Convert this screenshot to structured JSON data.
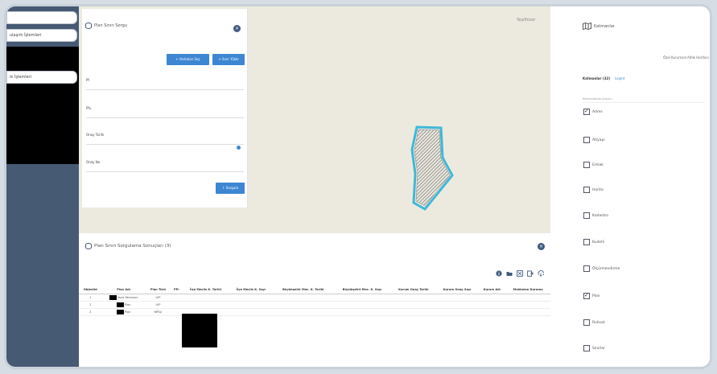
{
  "sidebar": {
    "items": [
      {
        "label": ""
      },
      {
        "label": "ulaşım İşlemleri"
      },
      {
        "label": ""
      },
      {
        "label": "ik İşlemleri"
      }
    ]
  },
  "map": {
    "place_label": "Yeşilhisar"
  },
  "search_panel": {
    "title": "Plan Sınırı Sorgu",
    "close_icon": "close-icon",
    "buttons": {
      "vertex": "+ Verkalan Seç",
      "draw": "+ Sınır Yükle",
      "query": "↑ Sorgula"
    },
    "fields": [
      {
        "label": "Pf."
      },
      {
        "label": "Pfv."
      },
      {
        "label": "Onay Tarihi"
      },
      {
        "label": "Onay No"
      }
    ]
  },
  "results": {
    "title": "Plan Sınırı Sorgulama Sonuçları (3)",
    "columns": [
      "Objectid",
      "Plan Adı",
      "Plan Türü",
      "PPı",
      "İlçe Meclis K. Tarihi",
      "İlçe Meclis K. Sayı",
      "Büyükşehir Mec. K. Tarihi",
      "Büyükşehir Mec. K. Sayı",
      "Kurum Onay Tarihi",
      "Kurum Onay Sayı",
      "Kurum Adı",
      "Mahkeme Durumu"
    ],
    "rows": [
      {
        "id": "1",
        "plan_adi": "İlave Revizyon",
        "plan_turu": "UIP"
      },
      {
        "id": "2",
        "plan_adi": "Plan",
        "plan_turu": "UIP"
      },
      {
        "id": "3",
        "plan_adi": "Plan",
        "plan_turu": "NPİİçi"
      }
    ]
  },
  "layers": {
    "title": "Katmanlar",
    "basemap": "Özel Kurumsal Altlık Haritası",
    "tabs": {
      "layers": "Katmanlar (32)",
      "legend": "Lejant"
    },
    "search_placeholder": "Katmanlarda Arayın...",
    "items": [
      {
        "label": "Adres",
        "checked": true
      },
      {
        "label": "Altyapı",
        "checked": false
      },
      {
        "label": "Emlak",
        "checked": false
      },
      {
        "label": "Harita",
        "checked": false
      },
      {
        "label": "Kadastro",
        "checked": false
      },
      {
        "label": "Kudelli",
        "checked": false
      },
      {
        "label": "Ölçümlendirme",
        "checked": false
      },
      {
        "label": "Plan",
        "checked": true
      },
      {
        "label": "Ruhsat",
        "checked": false
      },
      {
        "label": "Sınırlar",
        "checked": false
      }
    ]
  },
  "colors": {
    "accent": "#3d86d3",
    "sidebar": "#475a74",
    "parcel_outline": "#3fb8d8",
    "map_bg": "#eceadf"
  }
}
